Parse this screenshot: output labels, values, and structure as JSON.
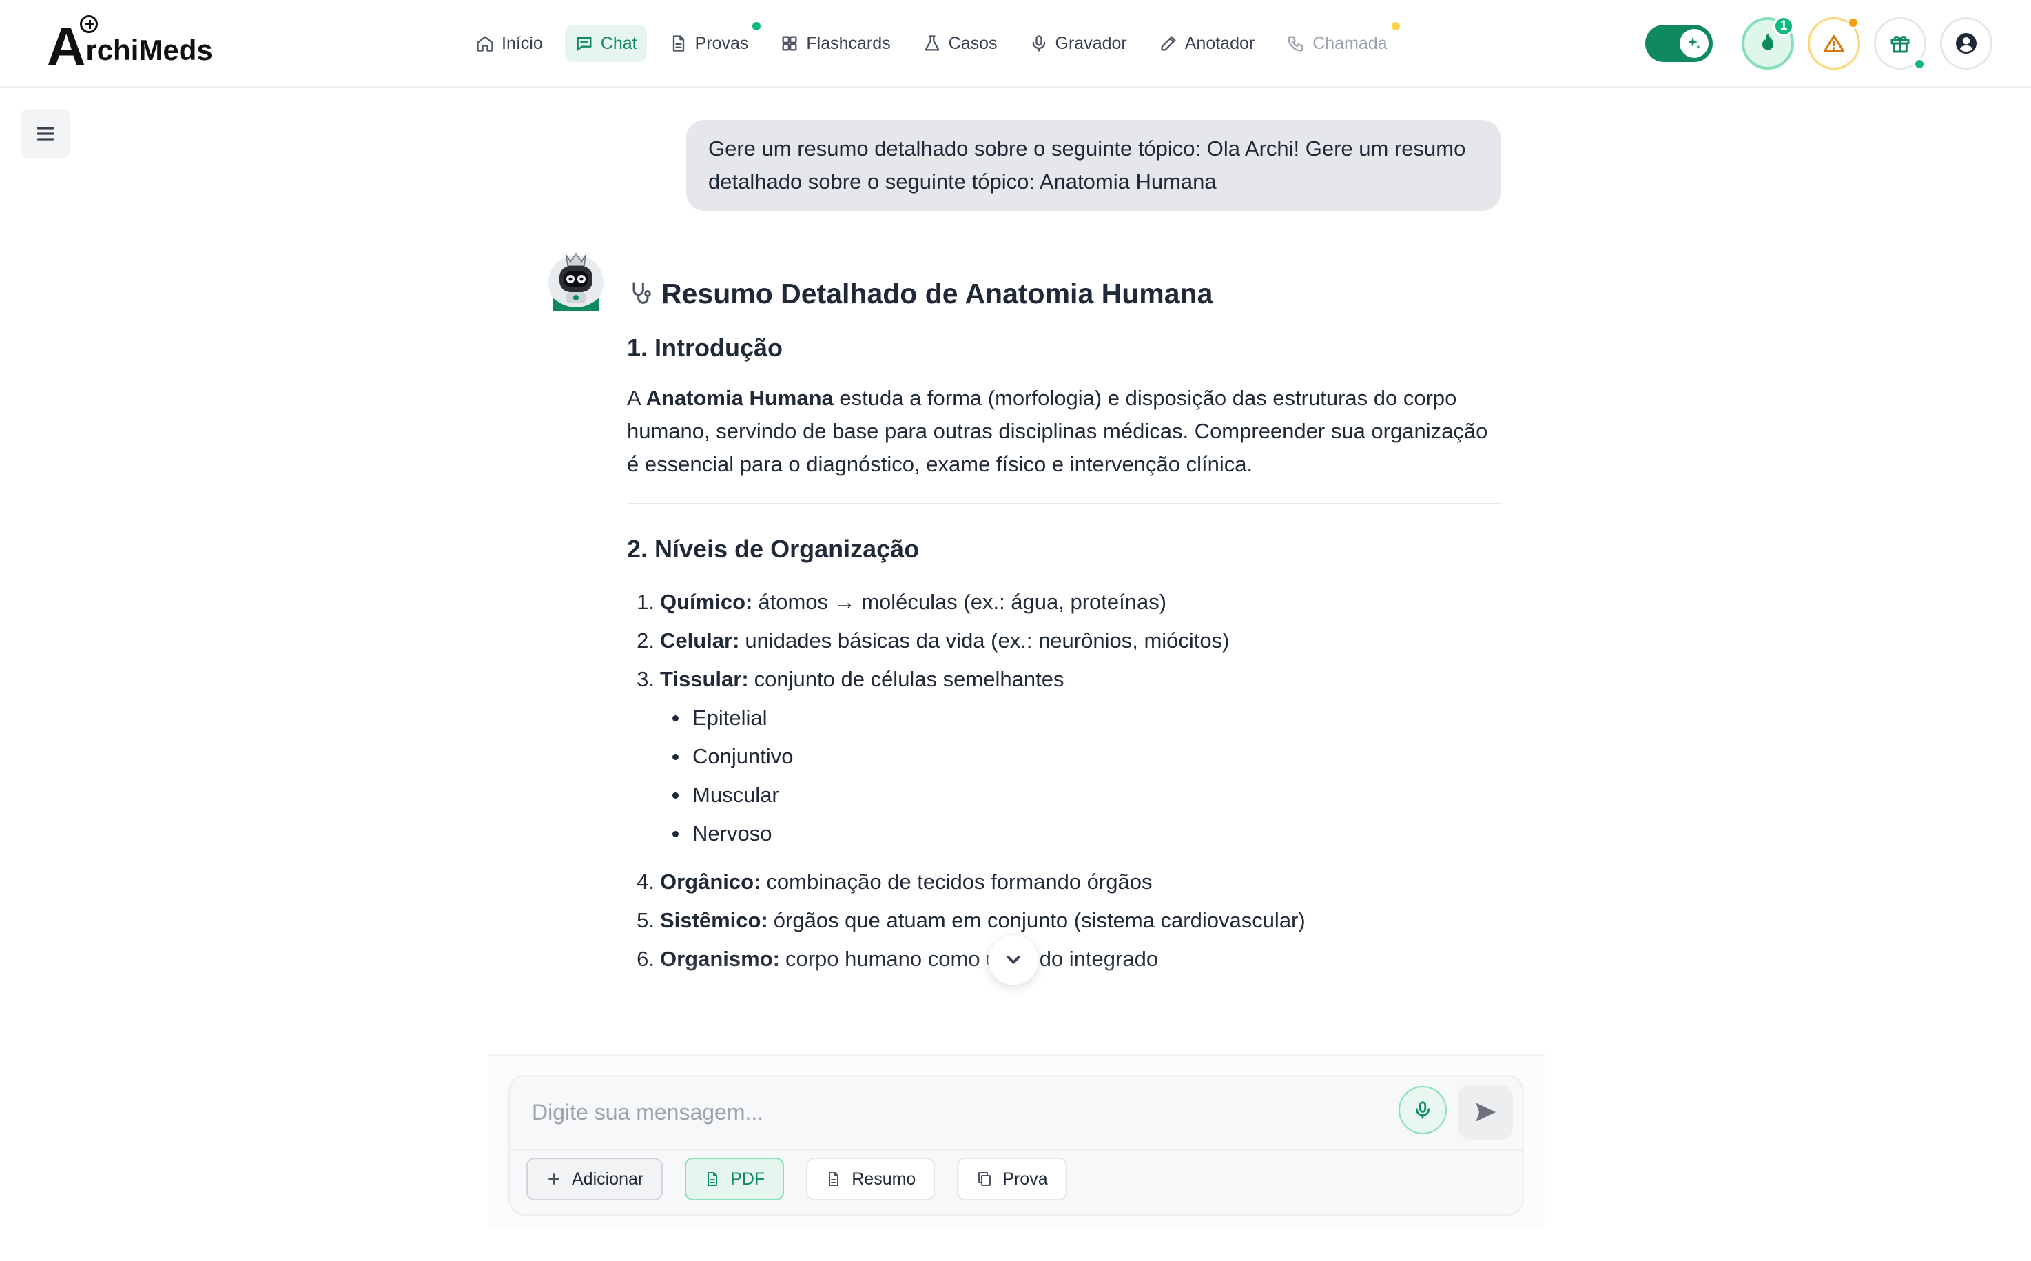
{
  "brand": {
    "logo_letter": "A",
    "logo_rest": "rchiMeds"
  },
  "nav": {
    "items": [
      {
        "label": "Início",
        "icon": "home-icon"
      },
      {
        "label": "Chat",
        "icon": "chat-icon",
        "active": true
      },
      {
        "label": "Provas",
        "icon": "document-icon",
        "dot": "#10b981"
      },
      {
        "label": "Flashcards",
        "icon": "flashcards-icon"
      },
      {
        "label": "Casos",
        "icon": "flask-icon"
      },
      {
        "label": "Gravador",
        "icon": "microphone-icon"
      },
      {
        "label": "Anotador",
        "icon": "pencil-icon"
      },
      {
        "label": "Chamada",
        "icon": "phone-icon",
        "disabled": true,
        "dot": "#fcd34d"
      }
    ]
  },
  "header_right": {
    "streak_count": "1",
    "colors": {
      "accent": "#0f8a5f",
      "warning": "#f59e0b",
      "success": "#10b981"
    }
  },
  "chat": {
    "user_message": "Gere um resumo detalhado sobre o seguinte tópico: Ola Archi! Gere um resumo detalhado sobre o seguinte tópico: Anatomia Humana",
    "answer": {
      "title": "Resumo Detalhado de Anatomia Humana",
      "intro_heading": "1. Introdução",
      "intro": {
        "prefix": "A ",
        "bold": "Anatomia Humana",
        "rest": " estuda a forma (morfologia) e disposição das estruturas do corpo humano, servindo de base para outras disciplinas médicas. Compreender sua organização é essencial para o diagnóstico, exame físico e intervenção clínica."
      },
      "levels_heading": "2. Níveis de Organização",
      "levels": [
        {
          "num": "1.",
          "term": "Químico:",
          "desc": "átomos → moléculas (ex.: água, proteínas)"
        },
        {
          "num": "2.",
          "term": "Celular:",
          "desc": "unidades básicas da vida (ex.: neurônios, miócitos)"
        },
        {
          "num": "3.",
          "term": "Tissular:",
          "desc": "conjunto de células semelhantes"
        },
        {
          "num": "4.",
          "term": "Orgânico:",
          "desc": "combinação de tecidos formando órgãos"
        },
        {
          "num": "5.",
          "term": "Sistêmico:",
          "desc": "órgãos que atuam em conjunto (sistema cardiovascular)"
        },
        {
          "num": "6.",
          "term": "Organismo:",
          "desc": "corpo humano como um todo integrado"
        }
      ],
      "tissues": [
        "Epitelial",
        "Conjuntivo",
        "Muscular",
        "Nervoso"
      ]
    }
  },
  "composer": {
    "placeholder": "Digite sua mensagem...",
    "chips": {
      "add": "Adicionar",
      "pdf": "PDF",
      "summary": "Resumo",
      "exam": "Prova"
    }
  }
}
